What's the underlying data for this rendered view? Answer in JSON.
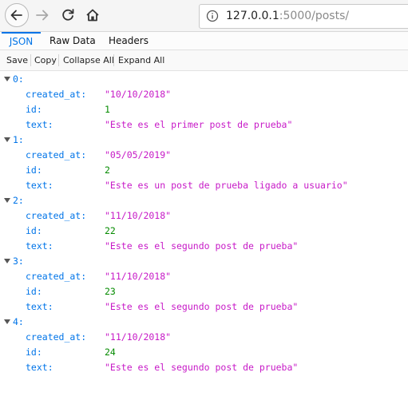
{
  "browser": {
    "url_host": "127.0.0.1",
    "url_rest": ":5000/posts/"
  },
  "viewer": {
    "tabs": [
      "JSON",
      "Raw Data",
      "Headers"
    ],
    "actions": [
      "Save",
      "Copy",
      "Collapse All",
      "Expand All"
    ]
  },
  "posts": [
    {
      "index": "0:",
      "created_at_key": "created_at:",
      "created_at": "\"10/10/2018\"",
      "id_key": "id:",
      "id": "1",
      "text_key": "text:",
      "text": "\"Este es el primer post de prueba\""
    },
    {
      "index": "1:",
      "created_at_key": "created_at:",
      "created_at": "\"05/05/2019\"",
      "id_key": "id:",
      "id": "2",
      "text_key": "text:",
      "text": "\"Este es un post de prueba ligado a usuario\""
    },
    {
      "index": "2:",
      "created_at_key": "created_at:",
      "created_at": "\"11/10/2018\"",
      "id_key": "id:",
      "id": "22",
      "text_key": "text:",
      "text": "\"Este es el segundo post de prueba\""
    },
    {
      "index": "3:",
      "created_at_key": "created_at:",
      "created_at": "\"11/10/2018\"",
      "id_key": "id:",
      "id": "23",
      "text_key": "text:",
      "text": "\"Este es el segundo post de prueba\""
    },
    {
      "index": "4:",
      "created_at_key": "created_at:",
      "created_at": "\"11/10/2018\"",
      "id_key": "id:",
      "id": "24",
      "text_key": "text:",
      "text": "\"Este es el segundo post de prueba\""
    }
  ],
  "colors": {
    "accent": "#0074e8",
    "string": "#c71ac7",
    "number": "#058b00"
  },
  "icons": [
    "back-icon",
    "forward-icon",
    "reload-icon",
    "home-icon",
    "info-icon",
    "expand-triangle-icon"
  ]
}
